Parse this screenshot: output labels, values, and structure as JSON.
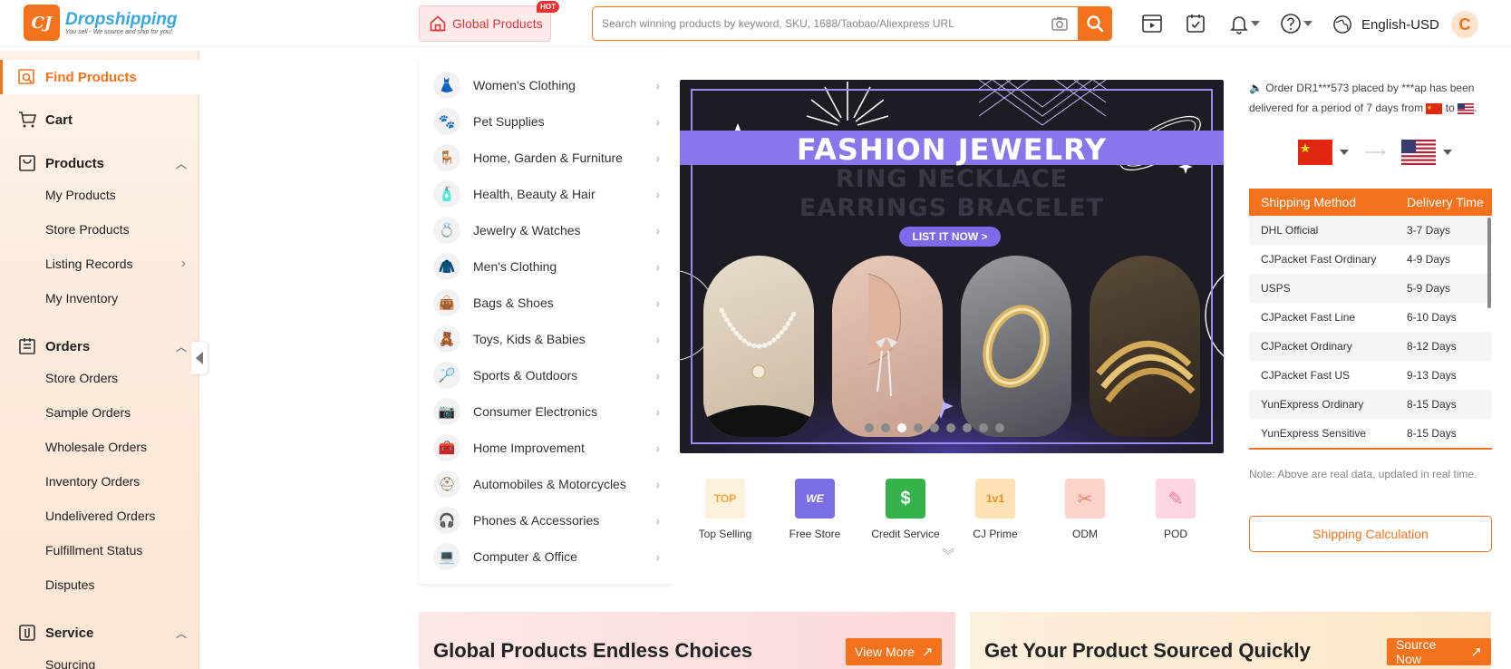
{
  "header": {
    "logo_mark": "CJ",
    "logo_name": "Dropshipping",
    "logo_tagline": "You sell - We source and ship for you!",
    "global_products_label": "Global Products",
    "hot_badge": "HOT",
    "search_placeholder": "Search winning products by keyword, SKU, 1688/Taobao/Aliexpress URL",
    "language_currency": "English-USD",
    "avatar_initial": "C"
  },
  "sidebar": {
    "find_products": "Find Products",
    "cart": "Cart",
    "products": {
      "label": "Products",
      "items": [
        "My Products",
        "Store Products",
        "Listing Records",
        "My Inventory"
      ]
    },
    "orders": {
      "label": "Orders",
      "items": [
        "Store Orders",
        "Sample Orders",
        "Wholesale Orders",
        "Inventory Orders",
        "Undelivered Orders",
        "Fulfillment Status",
        "Disputes"
      ]
    },
    "service": {
      "label": "Service",
      "items": [
        "Sourcing"
      ]
    }
  },
  "categories": [
    "Women's Clothing",
    "Pet Supplies",
    "Home, Garden & Furniture",
    "Health, Beauty & Hair",
    "Jewelry & Watches",
    "Men's Clothing",
    "Bags & Shoes",
    "Toys, Kids & Babies",
    "Sports & Outdoors",
    "Consumer Electronics",
    "Home Improvement",
    "Automobiles & Motorcycles",
    "Phones & Accessories",
    "Computer & Office"
  ],
  "banner": {
    "title": "FASHION JEWELRY",
    "subtitle_line1": "RING NECKLACE",
    "subtitle_line2": "EARRINGS BRACELET",
    "cta": "LIST IT NOW >",
    "active_slide": 3,
    "slide_count": 9
  },
  "features": [
    {
      "label": "Top Selling",
      "icon": "top-selling-icon",
      "glyph": "TOP",
      "color": "#f8a531"
    },
    {
      "label": "Free Store",
      "icon": "free-store-icon",
      "glyph": "WE",
      "color": "#7b6fe6"
    },
    {
      "label": "Credit Service",
      "icon": "credit-service-icon",
      "glyph": "$",
      "color": "#35b24a"
    },
    {
      "label": "CJ Prime",
      "icon": "cj-prime-icon",
      "glyph": "1v1",
      "color": "#f5a623"
    },
    {
      "label": "ODM",
      "icon": "odm-icon",
      "glyph": "✂",
      "color": "#f2826e"
    },
    {
      "label": "POD",
      "icon": "pod-icon",
      "glyph": "✎",
      "color": "#f47aa6"
    }
  ],
  "shipping": {
    "notice_part1": "Order DR1***573 placed by ***ap has been delivered for a period of 7 days from",
    "notice_to": "to",
    "notice_end": ".",
    "col_method": "Shipping Method",
    "col_time": "Delivery Time",
    "rows": [
      {
        "method": "DHL Official",
        "time": "3-7 Days"
      },
      {
        "method": "CJPacket Fast Ordinary",
        "time": "4-9 Days"
      },
      {
        "method": "USPS",
        "time": "5-9 Days"
      },
      {
        "method": "CJPacket Fast Line",
        "time": "6-10 Days"
      },
      {
        "method": "CJPacket Ordinary",
        "time": "8-12 Days"
      },
      {
        "method": "CJPacket Fast US",
        "time": "9-13 Days"
      },
      {
        "method": "YunExpress Ordinary",
        "time": "8-15 Days"
      },
      {
        "method": "YunExpress Sensitive",
        "time": "8-15 Days"
      }
    ],
    "note": "Note: Above are real data, updated in real time.",
    "calc_button": "Shipping Calculation"
  },
  "promos": [
    {
      "title": "Global Products Endless Choices",
      "button": "View More"
    },
    {
      "title": "Get Your Product Sourced Quickly",
      "button": "Source Now"
    }
  ],
  "colors": {
    "accent": "#f5721d",
    "link_blue": "#3aa7e0",
    "banner_purple": "#8677ec"
  }
}
